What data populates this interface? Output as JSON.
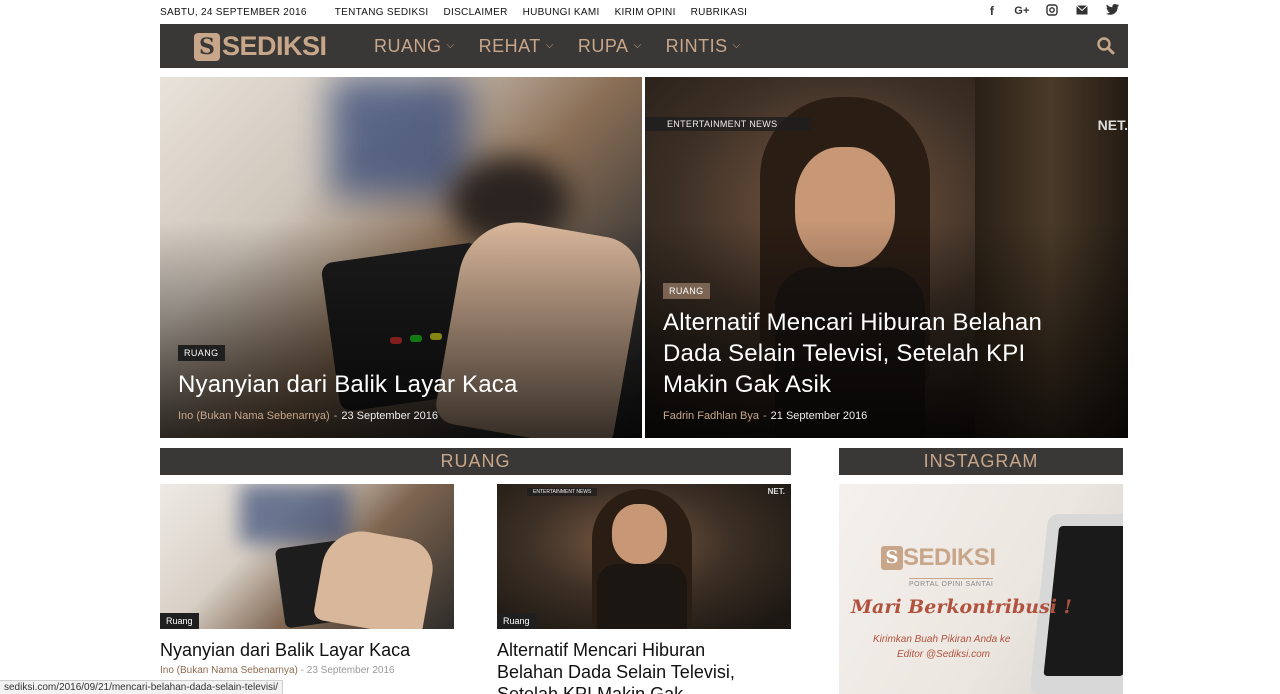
{
  "topbar": {
    "date": "SABTU, 24 SEPTEMBER 2016",
    "links": [
      "TENTANG SEDIKSI",
      "DISCLAIMER",
      "HUBUNGI KAMI",
      "KIRIM OPINI",
      "RUBRIKASI"
    ],
    "social_icons": [
      "facebook-icon",
      "google-plus-icon",
      "instagram-icon",
      "email-icon",
      "twitter-icon"
    ]
  },
  "nav": {
    "logo_mark": "S",
    "logo_text": "SEDIKSI",
    "menu": [
      "RUANG",
      "REHAT",
      "RUPA",
      "RINTIS"
    ],
    "accent": "#c8a68a",
    "background": "#3a3836"
  },
  "hero": [
    {
      "tag": "RUANG",
      "title": "Nyanyian dari Balik Layar Kaca",
      "author": "Ino (Bukan Nama Sebenarnya)",
      "date": "23 September 2016"
    },
    {
      "tag": "RUANG",
      "overlay_label": "ENTERTAINMENT NEWS",
      "overlay_brand": "NET.",
      "title": "Alternatif Mencari Hiburan Belahan Dada Selain Televisi, Setelah KPI Makin Gak Asik",
      "author": "Fadrin Fadhlan Bya",
      "date": "21 September 2016"
    }
  ],
  "sections": {
    "ruang": "RUANG",
    "instagram": "INSTAGRAM"
  },
  "cards": [
    {
      "tag": "Ruang",
      "title": "Nyanyian dari Balik Layar Kaca",
      "author": "Ino (Bukan Nama Sebenarnya)",
      "date": "23 September 2016"
    },
    {
      "tag": "Ruang",
      "overlay_label": "ENTERTAINMENT NEWS",
      "overlay_brand": "NET.",
      "title": "Alternatif Mencari Hiburan Belahan Dada Selain Televisi, Setelah KPI Makin Gak"
    }
  ],
  "instagram_post": {
    "logo_text": "SEDIKSI",
    "tagline": "PORTAL OPINI SANTAI",
    "headline": "Mari Berkontribusi !",
    "line1": "Kirimkan Buah Pikiran Anda ke",
    "line2": "Editor @Sediksi.com"
  },
  "status_url": "sediksi.com/2016/09/21/mencari-belahan-dada-selain-televisi/"
}
